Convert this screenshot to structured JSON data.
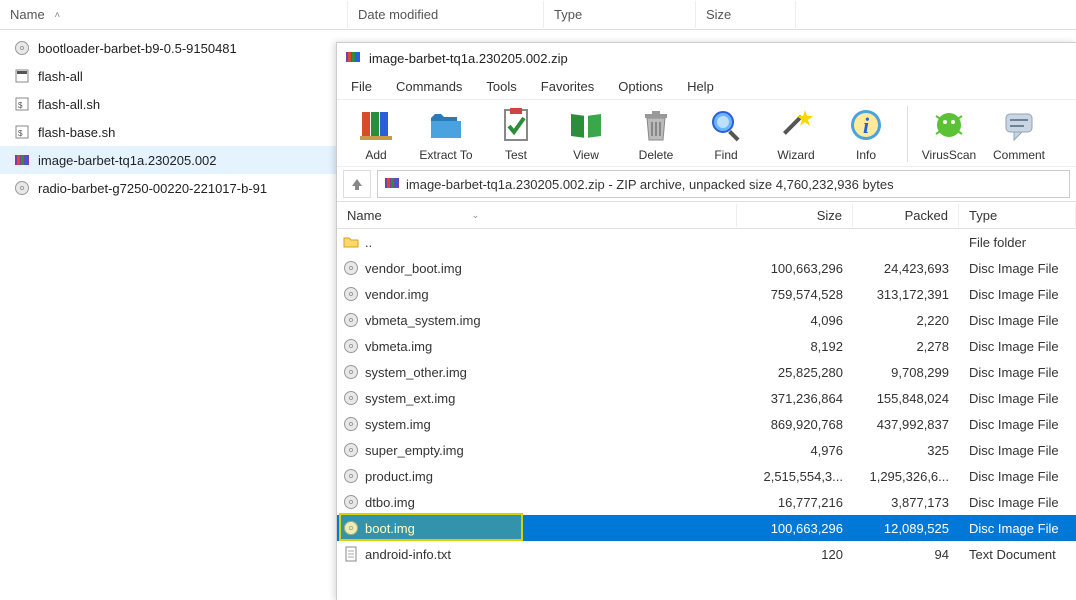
{
  "explorer": {
    "columns": {
      "name": "Name",
      "date": "Date modified",
      "type": "Type",
      "size": "Size"
    },
    "items": [
      {
        "name": "bootloader-barbet-b9-0.5-9150481",
        "icon": "disc-icon"
      },
      {
        "name": "flash-all",
        "icon": "batch-icon"
      },
      {
        "name": "flash-all.sh",
        "icon": "shell-icon"
      },
      {
        "name": "flash-base.sh",
        "icon": "shell-icon"
      },
      {
        "name": "image-barbet-tq1a.230205.002",
        "icon": "winrar-icon",
        "selected": true
      },
      {
        "name": "radio-barbet-g7250-00220-221017-b-91",
        "icon": "disc-icon"
      }
    ]
  },
  "winrar": {
    "title": "image-barbet-tq1a.230205.002.zip",
    "menus": [
      "File",
      "Commands",
      "Tools",
      "Favorites",
      "Options",
      "Help"
    ],
    "toolbar": [
      {
        "label": "Add",
        "icon": "books-icon"
      },
      {
        "label": "Extract To",
        "icon": "folder-out-icon"
      },
      {
        "label": "Test",
        "icon": "clipboard-check-icon"
      },
      {
        "label": "View",
        "icon": "book-open-icon"
      },
      {
        "label": "Delete",
        "icon": "trash-icon"
      },
      {
        "label": "Find",
        "icon": "find-icon"
      },
      {
        "label": "Wizard",
        "icon": "wand-icon"
      },
      {
        "label": "Info",
        "icon": "info-icon"
      },
      {
        "label": "VirusScan",
        "icon": "virus-icon",
        "sep_before": true
      },
      {
        "label": "Comment",
        "icon": "comment-icon"
      }
    ],
    "address": "image-barbet-tq1a.230205.002.zip - ZIP archive, unpacked size 4,760,232,936 bytes",
    "columns": {
      "name": "Name",
      "size": "Size",
      "packed": "Packed",
      "type": "Type"
    },
    "rows": [
      {
        "name": "..",
        "size": "",
        "packed": "",
        "type": "File folder",
        "icon": "folder-icon"
      },
      {
        "name": "vendor_boot.img",
        "size": "100,663,296",
        "packed": "24,423,693",
        "type": "Disc Image File",
        "icon": "disc-icon"
      },
      {
        "name": "vendor.img",
        "size": "759,574,528",
        "packed": "313,172,391",
        "type": "Disc Image File",
        "icon": "disc-icon"
      },
      {
        "name": "vbmeta_system.img",
        "size": "4,096",
        "packed": "2,220",
        "type": "Disc Image File",
        "icon": "disc-icon"
      },
      {
        "name": "vbmeta.img",
        "size": "8,192",
        "packed": "2,278",
        "type": "Disc Image File",
        "icon": "disc-icon"
      },
      {
        "name": "system_other.img",
        "size": "25,825,280",
        "packed": "9,708,299",
        "type": "Disc Image File",
        "icon": "disc-icon"
      },
      {
        "name": "system_ext.img",
        "size": "371,236,864",
        "packed": "155,848,024",
        "type": "Disc Image File",
        "icon": "disc-icon"
      },
      {
        "name": "system.img",
        "size": "869,920,768",
        "packed": "437,992,837",
        "type": "Disc Image File",
        "icon": "disc-icon"
      },
      {
        "name": "super_empty.img",
        "size": "4,976",
        "packed": "325",
        "type": "Disc Image File",
        "icon": "disc-icon"
      },
      {
        "name": "product.img",
        "size": "2,515,554,3...",
        "packed": "1,295,326,6...",
        "type": "Disc Image File",
        "icon": "disc-icon"
      },
      {
        "name": "dtbo.img",
        "size": "16,777,216",
        "packed": "3,877,173",
        "type": "Disc Image File",
        "icon": "disc-icon"
      },
      {
        "name": "boot.img",
        "size": "100,663,296",
        "packed": "12,089,525",
        "type": "Disc Image File",
        "icon": "disc-icon",
        "selected": true,
        "highlight": true
      },
      {
        "name": "android-info.txt",
        "size": "120",
        "packed": "94",
        "type": "Text Document",
        "icon": "text-icon"
      }
    ]
  }
}
